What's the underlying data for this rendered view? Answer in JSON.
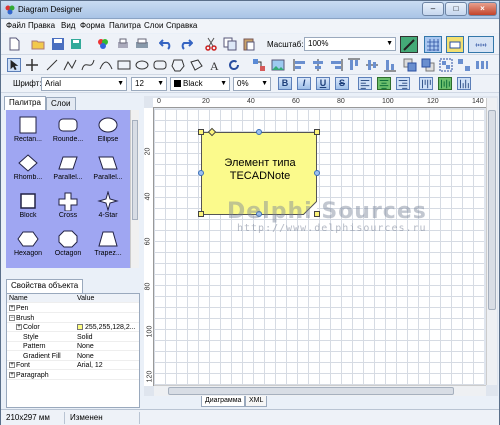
{
  "window": {
    "title": "Diagram Designer",
    "min": "–",
    "max": "□",
    "close": "×"
  },
  "menu": [
    "Файл",
    "Правка",
    "Вид",
    "Форма",
    "Палитра",
    "Слои",
    "Справка"
  ],
  "toolbar": {
    "zoom_label": "Масштаб:",
    "zoom_value": "100%",
    "dropdown_arrow": "▼"
  },
  "format": {
    "font_label": "Шрифт:",
    "font": "Arial",
    "size": "12",
    "color": "Black",
    "opacity": "0%",
    "bold": "B",
    "italic": "I",
    "underline": "U",
    "strike": "S"
  },
  "left_tabs": {
    "palette": "Палитра",
    "layers": "Слои"
  },
  "palette": [
    {
      "label": "Rectan...",
      "shape": "rect"
    },
    {
      "label": "Rounde...",
      "shape": "rounded"
    },
    {
      "label": "Ellipse",
      "shape": "ellipse"
    },
    {
      "label": "Rhomb...",
      "shape": "rhombus"
    },
    {
      "label": "Parallel...",
      "shape": "parallelogram"
    },
    {
      "label": "Parallel...",
      "shape": "parallelogram2"
    },
    {
      "label": "Block",
      "shape": "block"
    },
    {
      "label": "Cross",
      "shape": "cross"
    },
    {
      "label": "4-Star",
      "shape": "star4"
    },
    {
      "label": "Hexagon",
      "shape": "hexagon"
    },
    {
      "label": "Octagon",
      "shape": "octagon"
    },
    {
      "label": "Trapez...",
      "shape": "trapezoid"
    }
  ],
  "props": {
    "tab": "Свойства объекта",
    "header": {
      "name": "Name",
      "value": "Value"
    },
    "rows": [
      {
        "name": "Pen",
        "value": "",
        "exp": "+"
      },
      {
        "name": "Brush",
        "value": "",
        "exp": "−"
      },
      {
        "name": "Color",
        "value": "255,255,128,2...",
        "exp": "+"
      },
      {
        "name": "Style",
        "value": "Solid",
        "exp": ""
      },
      {
        "name": "Pattern",
        "value": "None",
        "exp": ""
      },
      {
        "name": "Gradient Fill",
        "value": "None",
        "exp": ""
      },
      {
        "name": "Font",
        "value": "Arial, 12",
        "exp": "+"
      },
      {
        "name": "Paragraph",
        "value": "",
        "exp": "+"
      }
    ]
  },
  "ruler": {
    "h": [
      "0",
      "20",
      "40",
      "60",
      "80",
      "100",
      "120",
      "140"
    ],
    "v": [
      "20",
      "40",
      "60",
      "80",
      "100",
      "120"
    ]
  },
  "canvas": {
    "note_text_1": "Элемент типа",
    "note_text_2": "TECADNote",
    "watermark_1": "Delphi Sources",
    "watermark_2": "http://www.delphisources.ru"
  },
  "doc_tabs": [
    "Диаграмма",
    "XML"
  ],
  "status": {
    "page_size": "210x297 мм",
    "state": "Изменен"
  }
}
